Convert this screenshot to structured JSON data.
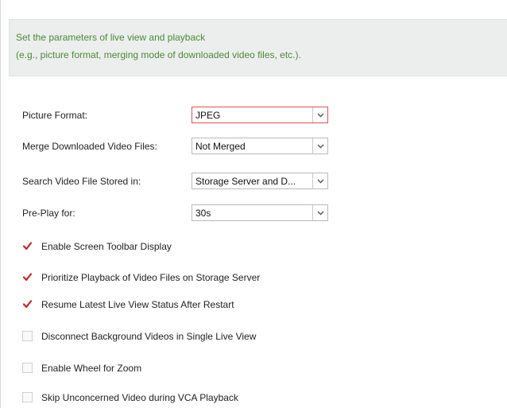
{
  "info": {
    "line1": "Set the parameters of live view and playback",
    "line2": "(e.g., picture format, merging mode of downloaded video files, etc.)."
  },
  "fields": [
    {
      "label": "Picture Format:",
      "value": "JPEG",
      "focused": true
    },
    {
      "label": "Merge Downloaded Video Files:",
      "value": "Not Merged",
      "focused": false
    },
    {
      "label": "Search Video File Stored in:",
      "value": "Storage Server and D...",
      "focused": false
    },
    {
      "label": "Pre-Play for:",
      "value": "30s",
      "focused": false
    }
  ],
  "options": [
    {
      "label": "Enable Screen Toolbar Display",
      "checked": true
    },
    {
      "label": "Prioritize Playback of Video Files on Storage Server",
      "checked": true
    },
    {
      "label": "Resume Latest Live View Status After Restart",
      "checked": true
    },
    {
      "label": "Disconnect Background Videos in Single Live View",
      "checked": false
    },
    {
      "label": "Enable Wheel for Zoom",
      "checked": false
    },
    {
      "label": "Skip Unconcerned Video during VCA Playback",
      "checked": false
    }
  ],
  "colors": {
    "info_text": "#4a8a33",
    "check_mark": "#cc2222",
    "focus_border": "#e05050"
  },
  "icons": {
    "dropdown": "chevron-down-icon",
    "check": "check-mark-icon"
  }
}
